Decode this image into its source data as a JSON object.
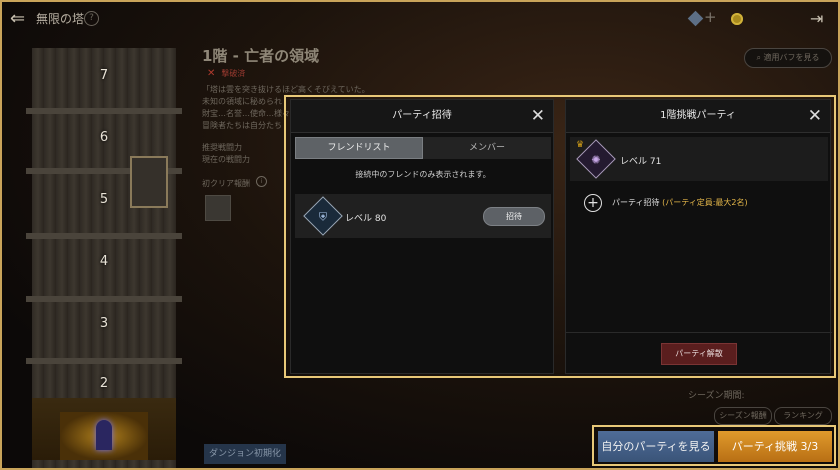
{
  "header": {
    "title": "無限の塔",
    "help": "?"
  },
  "tower": {
    "floors": [
      "7",
      "6",
      "5",
      "4",
      "3",
      "2"
    ]
  },
  "floor_info": {
    "title": "1階 - 亡者の領域",
    "status": "撃破済",
    "description": "「塔は雲を突き抜けるほど高くそびえていた。\n未知の領域に秘められ\n財宝…名誉…使命…様々\n冒険者たちは自分たち",
    "stats": "推奨戦闘力\n現在の戦闘力",
    "reward_label": "初クリア報酬",
    "buff_button": "適用バフを見る",
    "reset_button": "ダンジョン初期化",
    "season_label": "シーズン期間:",
    "season_ranking": "シーズン報酬",
    "ranking": "ランキング"
  },
  "invite_panel": {
    "title": "パーティ招待",
    "tabs": [
      "フレンドリスト",
      "メンバー"
    ],
    "notice": "接続中のフレンドのみ表示されます。",
    "friends": [
      {
        "level": "レベル 80",
        "invite_label": "招待"
      }
    ]
  },
  "party_panel": {
    "title": "1階挑戦パーティ",
    "leader_level": "レベル 71",
    "invite_label": "パーティ招待",
    "invite_cap": "(パーティ定員:最大2名)",
    "disband_label": "パーティ解散"
  },
  "bottom": {
    "view_party": "自分のパーティを見る",
    "challenge": "パーティ挑戦 3/3"
  },
  "colors": {
    "accent": "#e8c878",
    "challenge": "#e09a2c",
    "view_party": "#4f6c98",
    "disband": "#5a1e1e"
  }
}
